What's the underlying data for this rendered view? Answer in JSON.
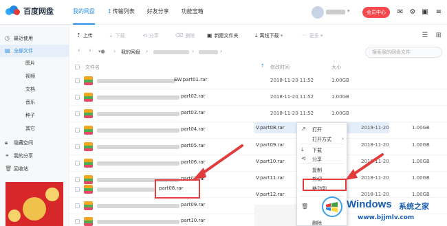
{
  "header": {
    "logo_text": "百度网盘",
    "nav": [
      {
        "label": "我的网盘",
        "active": true
      },
      {
        "label": "传输列表",
        "active": false
      },
      {
        "label": "好友分享",
        "active": false
      },
      {
        "label": "功能宝箱",
        "active": false
      }
    ],
    "member_label": "会员中心"
  },
  "sidebar": {
    "items": [
      {
        "label": "最近使用",
        "icon": "clock-icon"
      },
      {
        "label": "全部文件",
        "icon": "folder-icon",
        "active": true
      },
      {
        "label": "图片"
      },
      {
        "label": "视频"
      },
      {
        "label": "文档"
      },
      {
        "label": "音乐"
      },
      {
        "label": "种子"
      },
      {
        "label": "其它"
      },
      {
        "label": "隐藏空间",
        "icon": "lock-icon"
      },
      {
        "label": "我的分享",
        "icon": "share-icon"
      },
      {
        "label": "回收站",
        "icon": "trash-icon"
      }
    ]
  },
  "toolbar": {
    "upload": "上传",
    "download": "下载",
    "share": "分享",
    "delete": "删除",
    "new_folder": "新建文件夹",
    "offline": "离线下载",
    "more": "更多"
  },
  "breadcrumb": {
    "root": "我的网盘",
    "search_placeholder": "搜索我的网盘文件"
  },
  "list": {
    "col_name": "文件名",
    "col_date": "修改时间",
    "col_size": "大小",
    "rows": [
      {
        "name": "EW.part01.rar",
        "date": "2018-11-20 11:52",
        "size": "1.00GB"
      },
      {
        "name": "part02.rar",
        "date": "2018-11-20 11:52",
        "size": "1.00GB"
      },
      {
        "name": "part03.rar",
        "date": "2018-11-20 11:52",
        "size": "1.00GB"
      },
      {
        "name": "part04.rar",
        "date": "",
        "size": ""
      },
      {
        "name": "part05.rar",
        "date": "",
        "size": ""
      },
      {
        "name": "part06.rar",
        "date": "",
        "size": ""
      },
      {
        "name": "part07.rar",
        "date": "",
        "size": ""
      },
      {
        "name": "part08.rar",
        "date": "",
        "size": ""
      },
      {
        "name": "part09.rar",
        "date": "",
        "size": ""
      },
      {
        "name": "part10.rar",
        "date": "",
        "size": ""
      }
    ]
  },
  "overlay_list": {
    "rows": [
      {
        "name": "V.part08.rar",
        "date": "2018-11-20",
        "size": "1.00GB"
      },
      {
        "name": "V.part09.rar",
        "date": "2018-11-20",
        "size": "1.00GB"
      },
      {
        "name": "V.part10.rar",
        "date": "2018-11-20",
        "size": "1.00GB"
      },
      {
        "name": "V.part11.rar",
        "date": "2018-11-20",
        "size": "1.00GB"
      },
      {
        "name": "V.part12.rar",
        "date": "2018-11-20",
        "size": "1.00GB"
      }
    ]
  },
  "context_menu": {
    "items": [
      "打开",
      "打开方式",
      "下载",
      "分享",
      "复制",
      "剪切",
      "移动到",
      "删除"
    ]
  },
  "colors": {
    "accent": "#2b8ee8",
    "highlight": "#e23c3c"
  },
  "watermark": {
    "title": "Windows",
    "cn": "系统之家",
    "url": "www.bjjmlv.com"
  }
}
